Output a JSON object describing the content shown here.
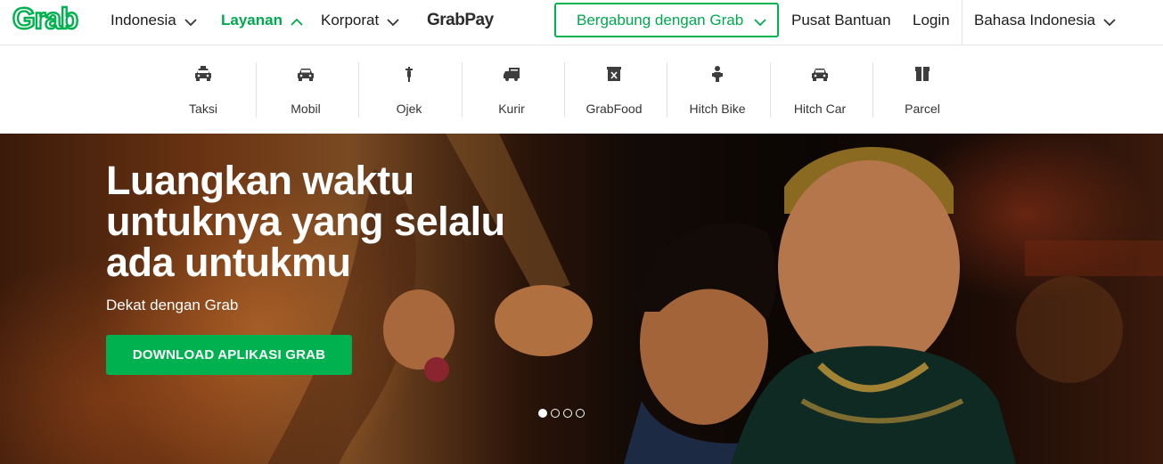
{
  "brand": {
    "logo_text": "Grab",
    "accent_color": "#00b14f"
  },
  "nav": {
    "country": "Indonesia",
    "services": "Layanan",
    "corporate": "Korporat",
    "grabpay_a": "Grab",
    "grabpay_b": "Pay",
    "join": "Bergabung dengan Grab",
    "help": "Pusat Bantuan",
    "login": "Login",
    "language": "Bahasa Indonesia"
  },
  "services": [
    {
      "label": "Taksi",
      "icon": "taxi-icon"
    },
    {
      "label": "Mobil",
      "icon": "car-icon"
    },
    {
      "label": "Ojek",
      "icon": "motorbike-icon"
    },
    {
      "label": "Kurir",
      "icon": "courier-icon"
    },
    {
      "label": "GrabFood",
      "icon": "food-icon"
    },
    {
      "label": "Hitch Bike",
      "icon": "hitch-bike-icon"
    },
    {
      "label": "Hitch Car",
      "icon": "hitch-car-icon"
    },
    {
      "label": "Parcel",
      "icon": "parcel-icon"
    }
  ],
  "hero": {
    "title_line1": "Luangkan waktu",
    "title_line2": "untuknya yang selalu",
    "title_line3": "ada untukmu",
    "subtitle": "Dekat dengan Grab",
    "cta": "DOWNLOAD APLIKASI GRAB",
    "slide_count": 4,
    "active_slide": 1
  }
}
